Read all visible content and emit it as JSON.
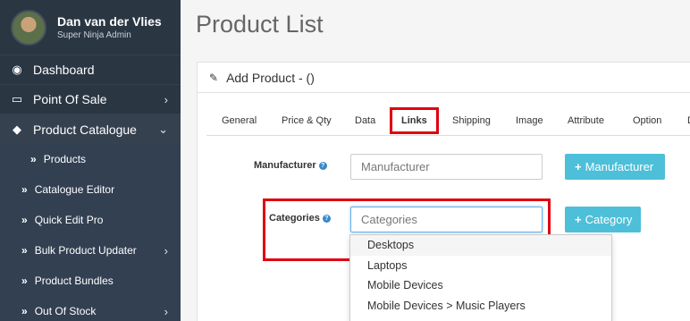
{
  "user": {
    "name": "Dan van der Vlies",
    "role": "Super Ninja Admin"
  },
  "sidebar": {
    "dashboard": {
      "icon": "tachometer-icon",
      "label": "Dashboard"
    },
    "pos": {
      "icon": "monitor-icon",
      "label": "Point Of Sale",
      "arrow": "›"
    },
    "catalogue": {
      "icon": "tags-icon",
      "label": "Product Catalogue",
      "arrow": "⌄"
    },
    "sub": {
      "products": "Products",
      "catalogue_editor": "Catalogue Editor",
      "quick_edit": "Quick Edit Pro",
      "bulk_updater": "Bulk Product Updater",
      "bundles": "Product Bundles",
      "out_of_stock": "Out Of Stock"
    },
    "sub_icon": "»",
    "arrow_right": "›"
  },
  "page": {
    "title": "Product List"
  },
  "panel": {
    "title": "Add Product - ()",
    "title_icon": "pencil-icon"
  },
  "tabs": [
    "General",
    "Price & Qty",
    "Data",
    "Links",
    "Shipping",
    "Image",
    "Attribute",
    "Option",
    "D"
  ],
  "active_tab": "Links",
  "form": {
    "manufacturer": {
      "label": "Manufacturer",
      "placeholder": "Manufacturer",
      "button": "Manufacturer"
    },
    "categories": {
      "label": "Categories",
      "placeholder": "Categories",
      "button": "Category"
    },
    "help_glyph": "?",
    "plus_glyph": "+"
  },
  "dropdown": [
    "Desktops",
    "Laptops",
    "Mobile Devices",
    "Mobile Devices  >  Music Players"
  ]
}
